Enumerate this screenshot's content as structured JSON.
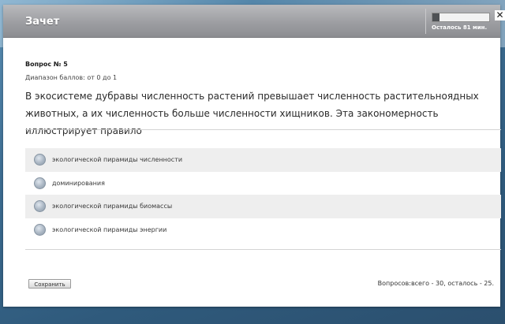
{
  "window": {
    "title": "Зачет",
    "timer": {
      "label": "Осталось 81 мин.",
      "progress_fraction": 0.12
    },
    "close_symbol": "✕"
  },
  "question": {
    "number_label": "Вопрос № 5",
    "score_range": "Диапазон баллов: от 0 до 1",
    "text": "В экосистеме дубравы численность растений превышает численность растительноядных животных, а их численность больше численности хищников. Эта закономерность иллюстрирует правило"
  },
  "options": [
    {
      "label": "экологической пирамиды численности"
    },
    {
      "label": "доминирования"
    },
    {
      "label": "экологической пирамиды биомассы"
    },
    {
      "label": "экологической пирамиды энергии"
    }
  ],
  "footer": {
    "save_label": "Сохранить",
    "progress_text": "Вопросов:всего - 30, осталось - 25."
  },
  "colors": {
    "titlebar": "#9d9ea2",
    "option_shade": "#eeeeee",
    "page_bg": "#3d6d92"
  }
}
